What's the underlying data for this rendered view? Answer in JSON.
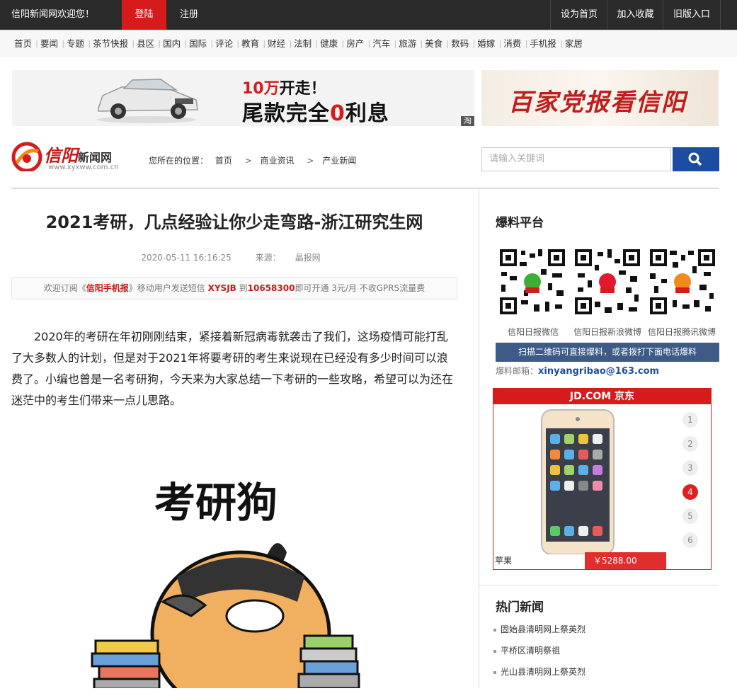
{
  "topbar": {
    "welcome": "信阳新闻网欢迎您！",
    "login": "登陆",
    "register": "注册",
    "set_home": "设为首页",
    "add_fav": "加入收藏",
    "old_version": "旧版入口"
  },
  "nav": [
    "首页",
    "要闻",
    "专题",
    "茶节快报",
    "县区",
    "国内",
    "国际",
    "评论",
    "教育",
    "财经",
    "法制",
    "健康",
    "房产",
    "汽车",
    "旅游",
    "美食",
    "数码",
    "婚嫁",
    "消费",
    "手机报",
    "家居"
  ],
  "ads": {
    "car_line1_prefix": "10万",
    "car_line1_suffix": "开走！",
    "car_line2_prefix": "尾款完全",
    "car_line2_zero": "0",
    "car_line2_suffix": "利息",
    "taobao_tag": "淘",
    "party_ad": "百家党报看信阳"
  },
  "logo": {
    "name": "信阳",
    "name_suffix": "新闻网",
    "url": "www.xyxww.com.cn"
  },
  "breadcrumb": {
    "prefix": "您所在的位置：",
    "items": [
      "首页",
      "商业资讯",
      "产业新闻"
    ],
    "separator": ">"
  },
  "search": {
    "placeholder": "请输入关键词"
  },
  "article": {
    "title": "2021考研，几点经验让你少走弯路-浙江研究生网",
    "date": "2020-05-11 16:16:25",
    "source_label": "来源：",
    "source": "晶报网",
    "subscribe_prefix": "欢迎订阅《",
    "subscribe_paper": "信阳手机报",
    "subscribe_mid": "》移动用户发送短信 ",
    "subscribe_code": "XYSJB",
    "subscribe_to": " 到",
    "subscribe_number": "10658300",
    "subscribe_suffix": "即可开通 3元/月 不收GPRS流量费",
    "body": "2020年的考研在年初刚刚结束，紧接着新冠病毒就袭击了我们，这场疫情可能打乱了大多数人的计划，但是对于2021年将要考研的考生来说现在已经没有多少时间可以浪费了。小编也曾是一名考研狗，今天来为大家总结一下考研的一些攻略，希望可以为还在迷茫中的考生们带来一点儿思路。",
    "illustration_text": "考研狗"
  },
  "sidebar": {
    "report_title": "爆料平台",
    "qr_labels": [
      "信阳日报微信",
      "信阳日报新浪微博",
      "信阳日报腾讯微博"
    ],
    "scan_banner": "扫描二维码可直接爆料，或者拨打下面电话爆料",
    "mail_label": "爆料邮箱：",
    "mail": "xinyangribao@163.com",
    "jd_header": "JD.COM 京东",
    "jd_numbers": [
      "1",
      "2",
      "3",
      "4",
      "5",
      "6"
    ],
    "jd_active": 4,
    "jd_product": "苹果",
    "jd_price": "￥5288.00",
    "hot_title": "热门新闻",
    "hot_news": [
      "固始县清明网上祭英烈",
      "平桥区清明祭祖",
      "光山县清明网上祭英烈"
    ]
  },
  "colors": {
    "topbar": "#2b2b2b",
    "accent_red": "#d51b1b",
    "search_blue": "#1b4ea1",
    "scan_banner": "#3d5b86"
  }
}
